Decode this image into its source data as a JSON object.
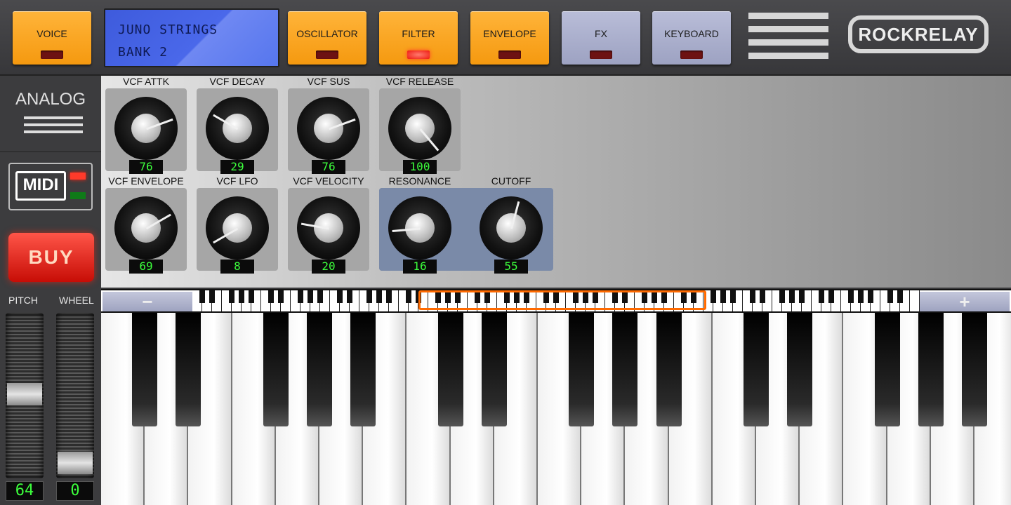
{
  "top": {
    "buttons": [
      {
        "label": "VOICE",
        "style": "orange",
        "led": "off"
      },
      {
        "label": "OSCILLATOR",
        "style": "orange",
        "led": "off"
      },
      {
        "label": "FILTER",
        "style": "orange",
        "led": "on"
      },
      {
        "label": "ENVELOPE",
        "style": "orange",
        "led": "off"
      },
      {
        "label": "FX",
        "style": "lav",
        "led": "off"
      },
      {
        "label": "KEYBOARD",
        "style": "lav",
        "led": "off"
      }
    ],
    "lcd": {
      "line1": "JUNO STRINGS",
      "line2": "BANK 2"
    },
    "logo": "ROCKRELAY"
  },
  "sidebar": {
    "analog_label": "ANALOG",
    "midi_label": "MIDI",
    "buy_label": "BUY",
    "pitch_label": "PITCH",
    "wheel_label": "WHEEL",
    "pitch_value": "64",
    "wheel_value": "0"
  },
  "knobs": [
    {
      "label": "VCF ATTK",
      "value": "76"
    },
    {
      "label": "VCF DECAY",
      "value": "29"
    },
    {
      "label": "VCF SUS",
      "value": "76"
    },
    {
      "label": "VCF RELEASE",
      "value": "100"
    },
    {
      "label": "VCF ENVELOPE",
      "value": "69"
    },
    {
      "label": "VCF LFO",
      "value": "8"
    },
    {
      "label": "VCF VELOCITY",
      "value": "20"
    },
    {
      "label": "RESONANCE",
      "value": "16"
    },
    {
      "label": "CUTOFF",
      "value": "55"
    }
  ],
  "mini_keyboard": {
    "minus_glyph": "−",
    "plus_glyph": "+"
  },
  "colors": {
    "accent_orange": "#f5990f",
    "lcd_blue": "#4a68ea",
    "led_red": "#ee1a10",
    "segment_green": "#3cff3c"
  }
}
